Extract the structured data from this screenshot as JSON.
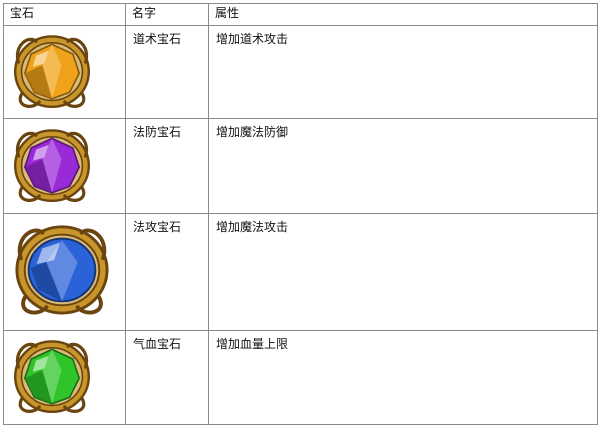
{
  "table": {
    "headers": {
      "image": "宝石",
      "name": "名字",
      "attribute": "属性"
    },
    "rows": [
      {
        "name": "道术宝石",
        "attribute": "增加道术攻击",
        "gem_color": "#f0a21a",
        "gem_icon": "orange-gem-icon"
      },
      {
        "name": "法防宝石",
        "attribute": "增加魔法防御",
        "gem_color": "#9a2ad8",
        "gem_icon": "purple-gem-icon"
      },
      {
        "name": "法攻宝石",
        "attribute": "增加魔法攻击",
        "gem_color": "#2a62d8",
        "gem_icon": "blue-gem-icon"
      },
      {
        "name": "气血宝石",
        "attribute": "增加血量上限",
        "gem_color": "#2fc52a",
        "gem_icon": "green-gem-icon"
      }
    ]
  },
  "colors": {
    "border": "#8a8a8a",
    "frame_gold": "#c8962a",
    "frame_dark": "#6b4510"
  }
}
